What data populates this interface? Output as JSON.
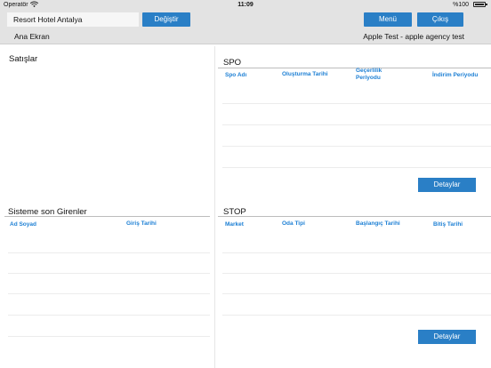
{
  "status_bar": {
    "carrier": "Operatör",
    "time": "11:09",
    "battery": "%100",
    "icons": [
      "wifi-icon",
      "battery-icon"
    ]
  },
  "header": {
    "hotel_value": "Resort Hotel Antalya",
    "change_label": "Değiştir",
    "menu_label": "Menü",
    "logout_label": "Çıkış",
    "breadcrumb": "Ana Ekran",
    "agency": "Apple Test - apple agency test"
  },
  "sales": {
    "title": "Satışlar"
  },
  "spo": {
    "title": "SPO",
    "columns": [
      "Spo Adı",
      "Oluşturma Tarihi",
      "Geçerlilik Periyodu",
      "İndirim Periyodu"
    ],
    "detail_label": "Detaylar"
  },
  "recent_logins": {
    "title": "Sisteme son Girenler",
    "columns": [
      "Ad Soyad",
      "Giriş Tarihi"
    ]
  },
  "stop": {
    "title": "STOP",
    "columns": [
      "Market",
      "Oda Tipi",
      "Başlangıç Tarihi",
      "Bitiş Tarihi"
    ],
    "detail_label": "Detaylar"
  },
  "colors": {
    "accent": "#2a7fc6",
    "header_bg": "#e3e3e3",
    "column_header": "#1c7fd4"
  }
}
